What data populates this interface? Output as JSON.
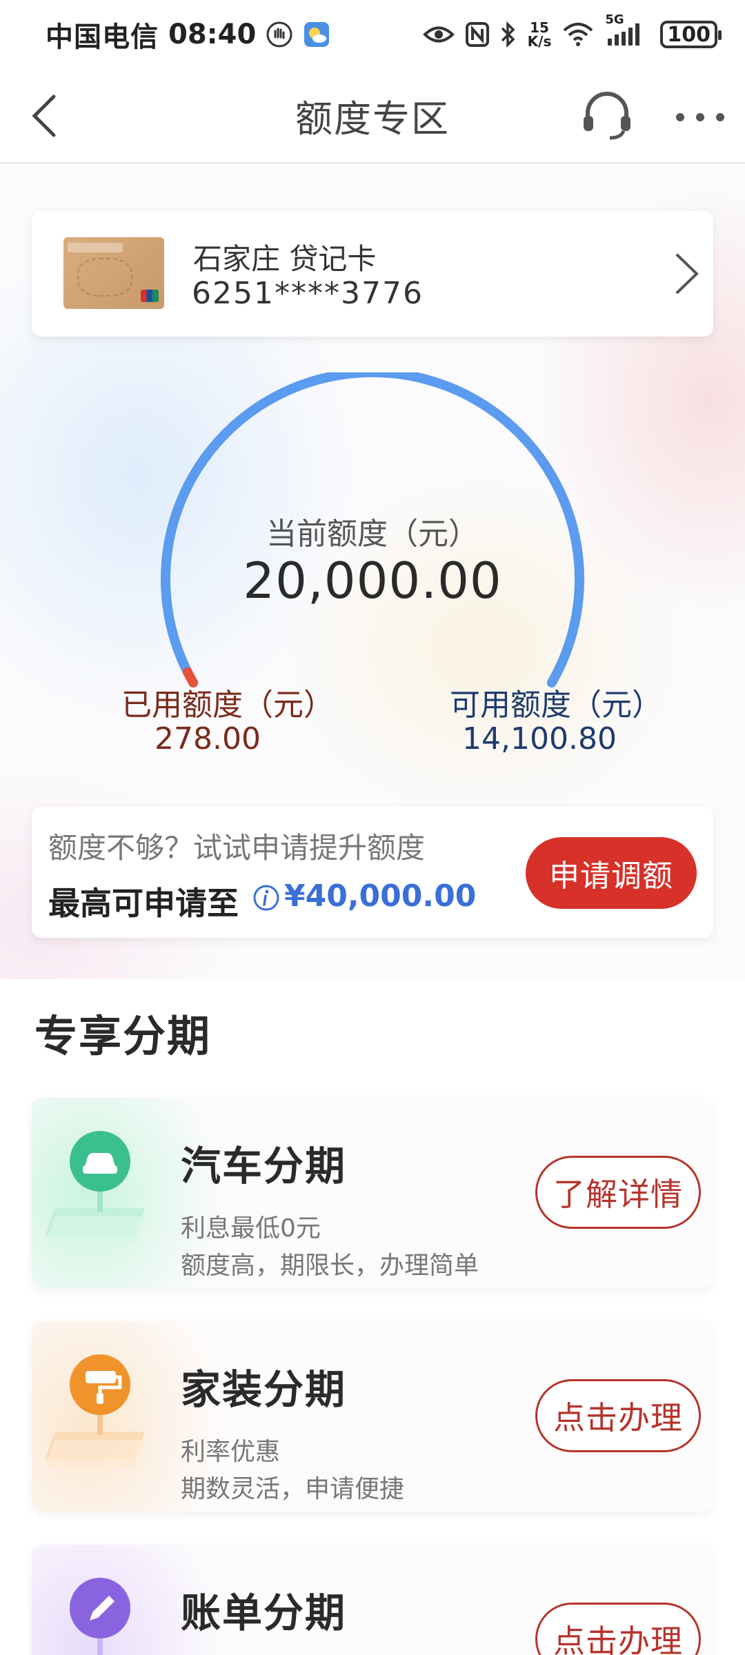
{
  "status_bar": {
    "carrier": "中国电信",
    "time": "08:40",
    "net_speed_value": "15",
    "net_speed_unit": "K/s",
    "signal_label": "5G",
    "battery": "100"
  },
  "header": {
    "title": "额度专区"
  },
  "card": {
    "name": "石家庄 贷记卡",
    "number": "6251****3776"
  },
  "limit": {
    "current_label": "当前额度（元）",
    "current_value": "20,000.00",
    "used_label": "已用额度（元）",
    "used_value": "278.00",
    "available_label": "可用额度（元）",
    "available_value": "14,100.80",
    "used_fraction": 0.0139
  },
  "increase": {
    "prompt": "额度不够？试试申请提升额度",
    "max_label": "最高可申请至",
    "max_value": "¥40,000.00",
    "button": "申请调额"
  },
  "section": {
    "title": "专享分期"
  },
  "installments": [
    {
      "title": "汽车分期",
      "sub1": "利息最低0元",
      "sub2": "额度高，期限长，办理简单",
      "button": "了解详情",
      "icon": "car-icon",
      "color": "#3cbf8f"
    },
    {
      "title": "家装分期",
      "sub1": "利率优惠",
      "sub2": "期数灵活，申请便捷",
      "button": "点击办理",
      "icon": "paint-roller-icon",
      "color": "#f0932b"
    },
    {
      "title": "账单分期",
      "sub1": "",
      "sub2": "",
      "button": "点击办理",
      "icon": "pen-icon",
      "color": "#8a63e0"
    }
  ],
  "colors": {
    "accent_red": "#d7312a",
    "gauge_blue": "#5b9bf0",
    "gauge_used": "#e5533b",
    "link_blue": "#3b6fd8"
  }
}
